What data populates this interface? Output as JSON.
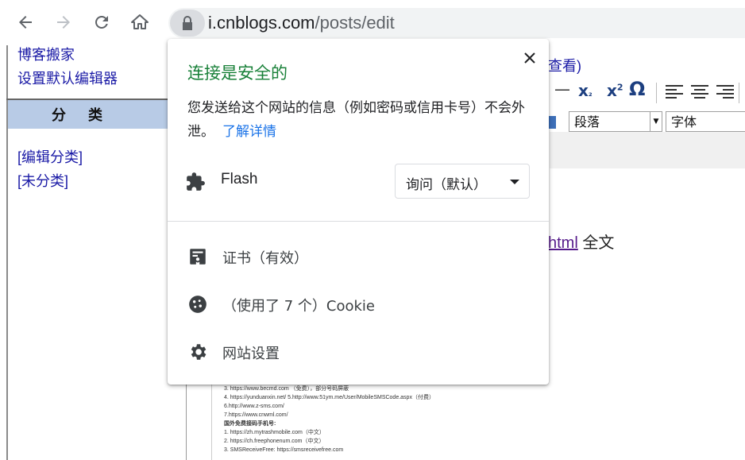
{
  "browser": {
    "url_host": "i.cnblogs.com",
    "url_path": "/posts/edit",
    "icons": [
      "back-icon",
      "forward-icon",
      "reload-icon",
      "home-icon",
      "lock-icon"
    ]
  },
  "page": {
    "sidebar_links": [
      "博客搬家",
      "设置默认编辑器"
    ],
    "category_header": "分类",
    "category_links": [
      "[编辑分类]",
      "[未分类]"
    ],
    "right_fragment_top": "查看)",
    "right_fragment_mid_link": "html",
    "right_fragment_mid_text": "全文",
    "format_select": "段落",
    "font_select": "字体",
    "doc_lines": [
      "3. https://www.becmd.com （免费），部分号码屏蔽",
      "4. https://yunduanxin.net/ 5.http://www.51ym.me/User/MobileSMSCode.aspx（付费）",
      "6.http://www.z-sms.com/",
      "7.https://www.cnwml.com/",
      "国外免费接码手机号:",
      "1. https://zh.mytrashmobile.com（中文）",
      "2. https://ch.freephonenum.com（中文）",
      "3. SMSReceiveFree: https://smsreceivefree.com"
    ]
  },
  "popup": {
    "title": "连接是安全的",
    "description": "您发送给这个网站的信息（例如密码或信用卡号）不会外泄。",
    "learn_more": "了解详情",
    "permission_label": "Flash",
    "permission_value": "询问（默认）",
    "menu": [
      {
        "label": "证书（有效）",
        "icon": "certificate-icon"
      },
      {
        "label": "（使用了 7 个）Cookie",
        "icon": "cookie-icon"
      },
      {
        "label": "网站设置",
        "icon": "gear-icon"
      }
    ],
    "colors": {
      "title": "#188038",
      "link": "#1a73e8"
    }
  }
}
